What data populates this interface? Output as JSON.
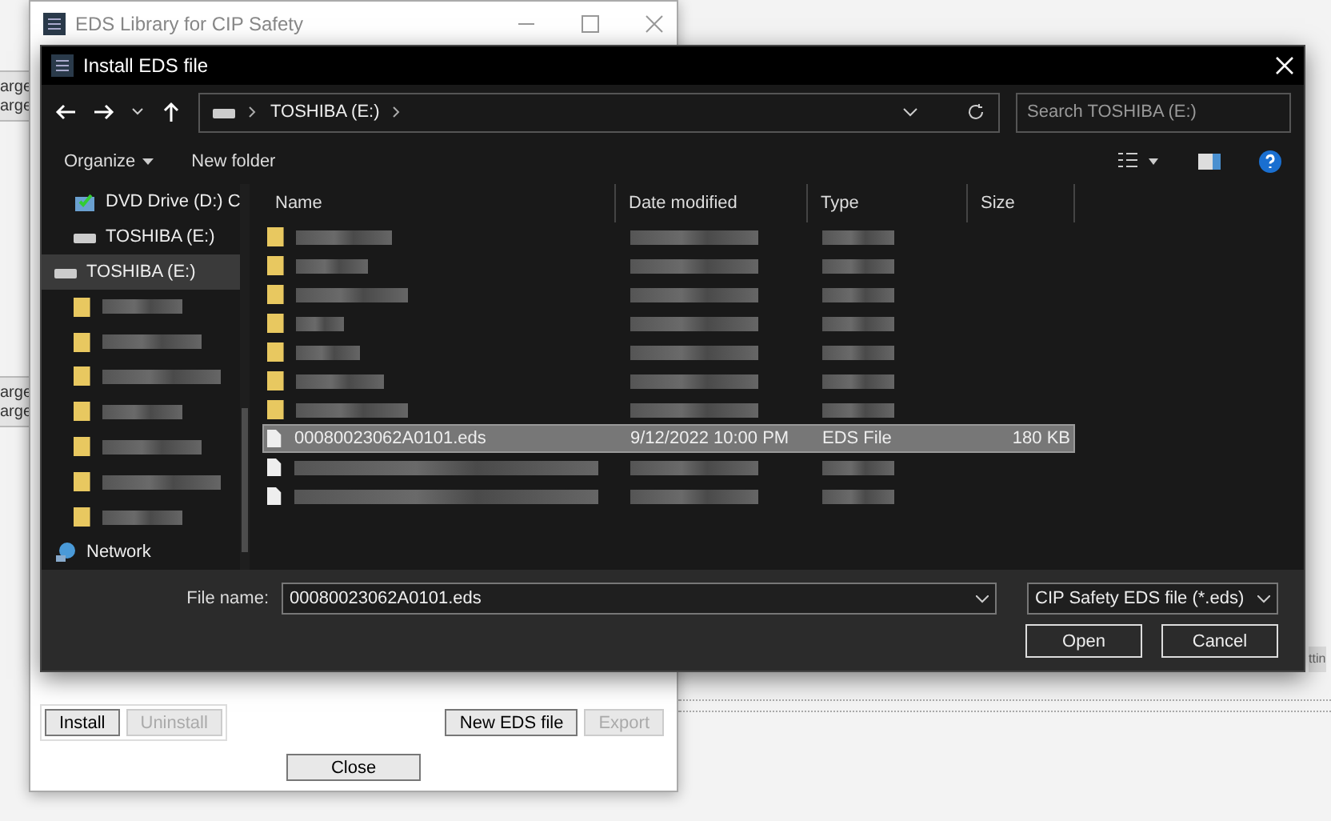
{
  "background": {
    "fragments": [
      "arge",
      "arge",
      "arge",
      "arge"
    ],
    "right_fragment": "ttin"
  },
  "library_window": {
    "title": "EDS Library for CIP Safety",
    "buttons": [
      {
        "label": "Install",
        "disabled": false
      },
      {
        "label": "Uninstall",
        "disabled": true
      }
    ],
    "right_buttons": [
      {
        "label": "New EDS file",
        "disabled": false
      },
      {
        "label": "Export",
        "disabled": true
      }
    ],
    "close_button": "Close"
  },
  "dialog": {
    "title": "Install EDS file",
    "breadcrumb": [
      "TOSHIBA (E:)"
    ],
    "search": {
      "placeholder": "Search TOSHIBA (E:)"
    },
    "toolbar": {
      "organize": "Organize",
      "new_folder": "New folder"
    },
    "nav_pane": [
      {
        "kind": "dvd",
        "label": "DVD Drive (D:) C",
        "selected": false,
        "indent": true
      },
      {
        "kind": "drive",
        "label": "TOSHIBA (E:)",
        "selected": false,
        "indent": true
      },
      {
        "kind": "drive",
        "label": "TOSHIBA (E:)",
        "selected": true,
        "indent": false
      },
      {
        "kind": "folder",
        "redacted": true,
        "selected": false,
        "indent": true
      },
      {
        "kind": "folder",
        "redacted": true,
        "selected": false,
        "indent": true
      },
      {
        "kind": "folder",
        "redacted": true,
        "selected": false,
        "indent": true
      },
      {
        "kind": "folder",
        "redacted": true,
        "selected": false,
        "indent": true
      },
      {
        "kind": "folder",
        "redacted": true,
        "selected": false,
        "indent": true
      },
      {
        "kind": "folder",
        "redacted": true,
        "selected": false,
        "indent": true
      },
      {
        "kind": "folder",
        "redacted": true,
        "selected": false,
        "indent": true
      },
      {
        "kind": "network",
        "label": "Network",
        "selected": false,
        "indent": false
      }
    ],
    "columns": [
      "Name",
      "Date modified",
      "Type",
      "Size"
    ],
    "files": [
      {
        "kind": "folder",
        "redacted": true,
        "selected": false
      },
      {
        "kind": "folder",
        "redacted": true,
        "selected": false
      },
      {
        "kind": "folder",
        "redacted": true,
        "selected": false
      },
      {
        "kind": "folder",
        "redacted": true,
        "selected": false
      },
      {
        "kind": "folder",
        "redacted": true,
        "selected": false
      },
      {
        "kind": "folder",
        "redacted": true,
        "selected": false
      },
      {
        "kind": "folder",
        "redacted": true,
        "selected": false
      },
      {
        "kind": "file",
        "redacted": false,
        "selected": true,
        "name": "00080023062A0101.eds",
        "date": "9/12/2022 10:00 PM",
        "type": "EDS File",
        "size": "180 KB"
      },
      {
        "kind": "file",
        "redacted": true,
        "selected": false
      },
      {
        "kind": "file",
        "redacted": true,
        "selected": false
      }
    ],
    "file_name_label": "File name:",
    "file_name": "00080023062A0101.eds",
    "filter": "CIP Safety EDS file (*.eds)",
    "buttons": [
      "Open",
      "Cancel"
    ]
  }
}
